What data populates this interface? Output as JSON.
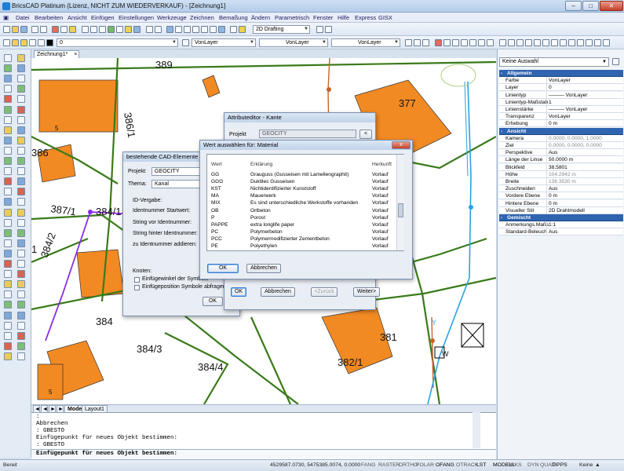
{
  "window": {
    "title": "BricsCAD Platinum (Lizenz, NICHT ZUM WIEDERVERKAUF) - [Zeichnung1]"
  },
  "menu": [
    "Datei",
    "Bearbeiten",
    "Ansicht",
    "Einfügen",
    "Einstellungen",
    "Werkzeuge",
    "Zeichnen",
    "Bemaßung",
    "Ändern",
    "Parametrisch",
    "Fenster",
    "Hilfe",
    "Express",
    "GISX"
  ],
  "toolbar": {
    "workspace": "2D Drafting",
    "layer": "0",
    "color": "VonLayer",
    "linetype": "VonLayer",
    "lineweight": "VonLayer"
  },
  "tabs": {
    "drawing": "Zeichnung1*",
    "model": "Model",
    "layout": "Layout1"
  },
  "map_labels": [
    "389",
    "377",
    "386",
    "387/1",
    "384/1",
    "384/2",
    "386/1",
    "384",
    "384/3",
    "384/4",
    "381",
    "382/1",
    "1",
    "5",
    "5",
    "W",
    "Y"
  ],
  "command_lines": [
    ":",
    "Abbrechen",
    ": GBESTO",
    "Einfügepunkt für neues Objekt bestimmen:",
    ": GBESTO"
  ],
  "command_prompt": "Einfügepunkt für neues Objekt bestimmen:",
  "status": {
    "left": "Bereit",
    "coords": "4529587.0730, 5475385.0074, 0.0000",
    "toggles": [
      "FANG",
      "RASTER",
      "ORTHO",
      "POLAR",
      "OFANG",
      "OTRACK",
      "LST",
      "MODELL",
      "DBKS",
      "DYN",
      "QUAD",
      "TIPPS"
    ],
    "last": "Keine"
  },
  "properties": {
    "selection": "Keine Auswahl",
    "groups": [
      {
        "title": "Allgemein",
        "rows": [
          {
            "k": "Farbe",
            "v": "VonLayer"
          },
          {
            "k": "Layer",
            "v": "0"
          },
          {
            "k": "Linientyp",
            "v": "——— VonLayer"
          },
          {
            "k": "Linientyp-Maßstab",
            "v": "1"
          },
          {
            "k": "Linienstärke",
            "v": "——— VonLayer"
          },
          {
            "k": "Transparenz",
            "v": "VonLayer"
          },
          {
            "k": "Erhebung",
            "v": "0 m"
          }
        ]
      },
      {
        "title": "Ansicht",
        "rows": [
          {
            "k": "Kamera",
            "v": "0.0000, 0.0000, 1.0000"
          },
          {
            "k": "Ziel",
            "v": "0.0000, 0.0000, 0.0000"
          },
          {
            "k": "Perspektive",
            "v": "Aus"
          },
          {
            "k": "Länge der Linse",
            "v": "50.0000 m"
          },
          {
            "k": "Blickfeld",
            "v": "38.5801"
          },
          {
            "k": "Höhe",
            "v": "104.2942 m"
          },
          {
            "k": "Breite",
            "v": "136.3530 m"
          },
          {
            "k": "Zuschneiden",
            "v": "Aus"
          },
          {
            "k": "Vordere Ebene",
            "v": "0 m"
          },
          {
            "k": "Hintere Ebene",
            "v": "0 m"
          },
          {
            "k": "Visueller Stil",
            "v": "2D Drahtmodell"
          }
        ]
      },
      {
        "title": "Gemischt",
        "rows": [
          {
            "k": "Anmerkungs.Maßs",
            "v": "1:1"
          },
          {
            "k": "Standard-Beleuch",
            "v": "Aus"
          }
        ]
      }
    ]
  },
  "dlg_cad": {
    "title": "bestehende CAD-Elemente zu",
    "projekt_label": "Projekt:",
    "projekt_value": "GEOCITY",
    "thema_label": "Thema:",
    "thema_value": "Kanal",
    "idvergabe": "ID-Vergabe:",
    "startwert": "Identnummer Startwert:",
    "string_vor": "String vor Identnummer:",
    "string_hinter": "String hinter Identnummer:",
    "addieren": "zu Identnummer addieren:",
    "knoten": "Knoten:",
    "chk1": "Einfügewinkel der Symbole",
    "chk2": "Einfügeposition Symbole abfragen",
    "ok": "OK"
  },
  "dlg_attr": {
    "title": "Attributeditor - Kante",
    "projekt_label": "Projekt",
    "projekt_value": "GEOCITY",
    "btn_ok": "OK",
    "btn_cancel": "Abbrechen",
    "btn_back": "<Zurück",
    "btn_next": "Weiter>"
  },
  "dlg_wert": {
    "title": "Wert auswählen für: Material",
    "columns": [
      "Wert",
      "Erklärung",
      "Herkunft"
    ],
    "rows": [
      [
        "GG",
        "Grauguss (Gusseisen mit Lamellengraphit)",
        "Vorlauf"
      ],
      [
        "GGG",
        "Duktiles Gusseisen",
        "Vorlauf"
      ],
      [
        "KST",
        "Nichtidentifizierter Kunststoff",
        "Vorlauf"
      ],
      [
        "MA",
        "Mauerwerk",
        "Vorlauf"
      ],
      [
        "MIX",
        "Es sind unterschiedliche Werkstoffe vorhanden",
        "Vorlauf"
      ],
      [
        "OB",
        "Ortbeton",
        "Vorlauf"
      ],
      [
        "P",
        "Porost",
        "Vorlauf"
      ],
      [
        "PAPPE",
        "extra longlife paper",
        "Vorlauf"
      ],
      [
        "PC",
        "Polymerbeton",
        "Vorlauf"
      ],
      [
        "PCC",
        "Polymermodifizierter Zementbeton",
        "Vorlauf"
      ],
      [
        "PE",
        "Polyethylen",
        "Vorlauf"
      ]
    ],
    "ok": "OK",
    "cancel": "Abbrechen",
    "close": "x"
  },
  "colors": {
    "building": "#f28a23",
    "parcel": "#3a7a1a",
    "pipe_blue": "#29a3df",
    "pipe_purple": "#8a2be2",
    "pipe_brown": "#c8622b"
  }
}
